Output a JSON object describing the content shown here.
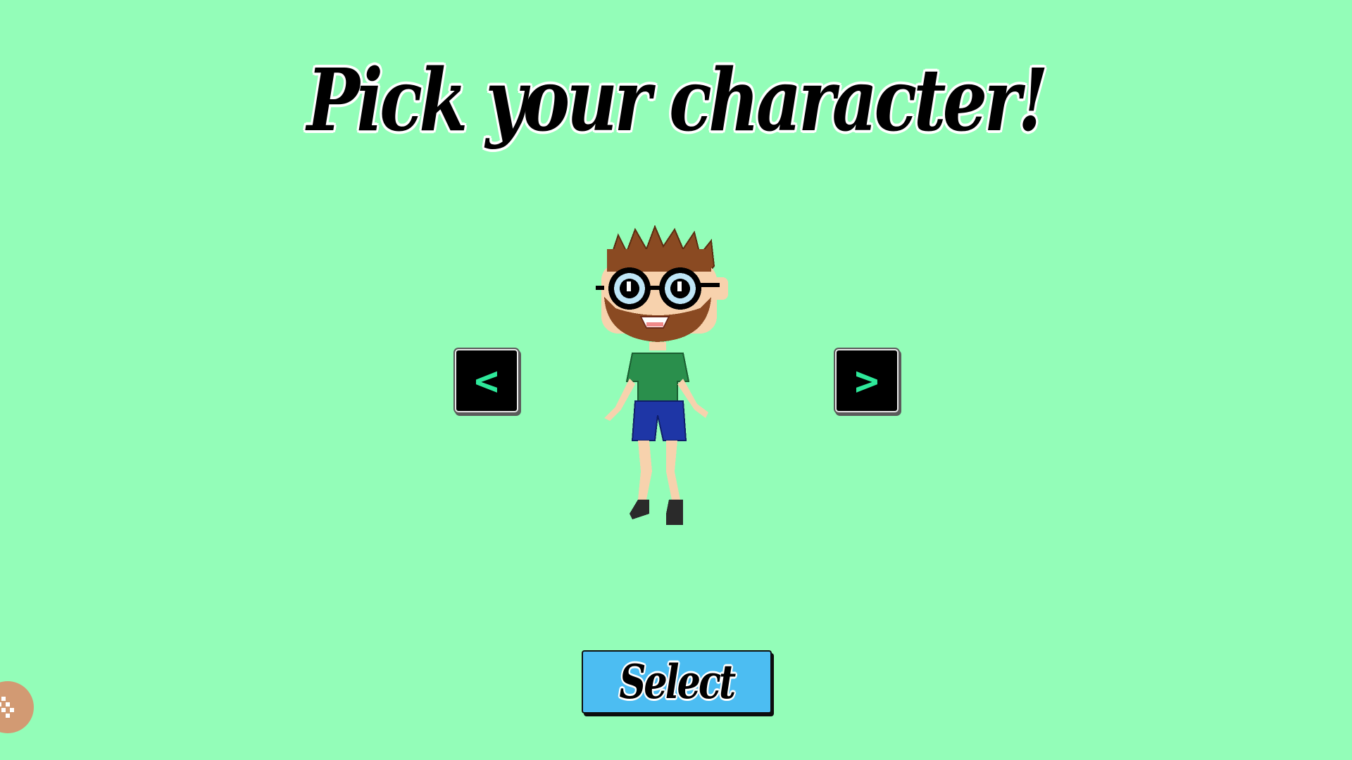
{
  "screen": {
    "background_color": "#93fdb8",
    "title": "Pick your character!"
  },
  "navigation": {
    "prev_label": "<",
    "next_label": ">",
    "arrow_color": "#2ee89a"
  },
  "select_button": {
    "label": "Select",
    "color": "#4cbdf2"
  },
  "character": {
    "icon": "bearded-character-sprite-icon",
    "hair_color": "#8a4a22",
    "skin_color": "#f7d2ad",
    "shirt_color": "#2a8f4c",
    "shorts_color": "#1e36a6",
    "lens_color": "#bfe6f7"
  },
  "corner_badge": {
    "icon": "game-menu-icon",
    "color": "#d29a73"
  }
}
